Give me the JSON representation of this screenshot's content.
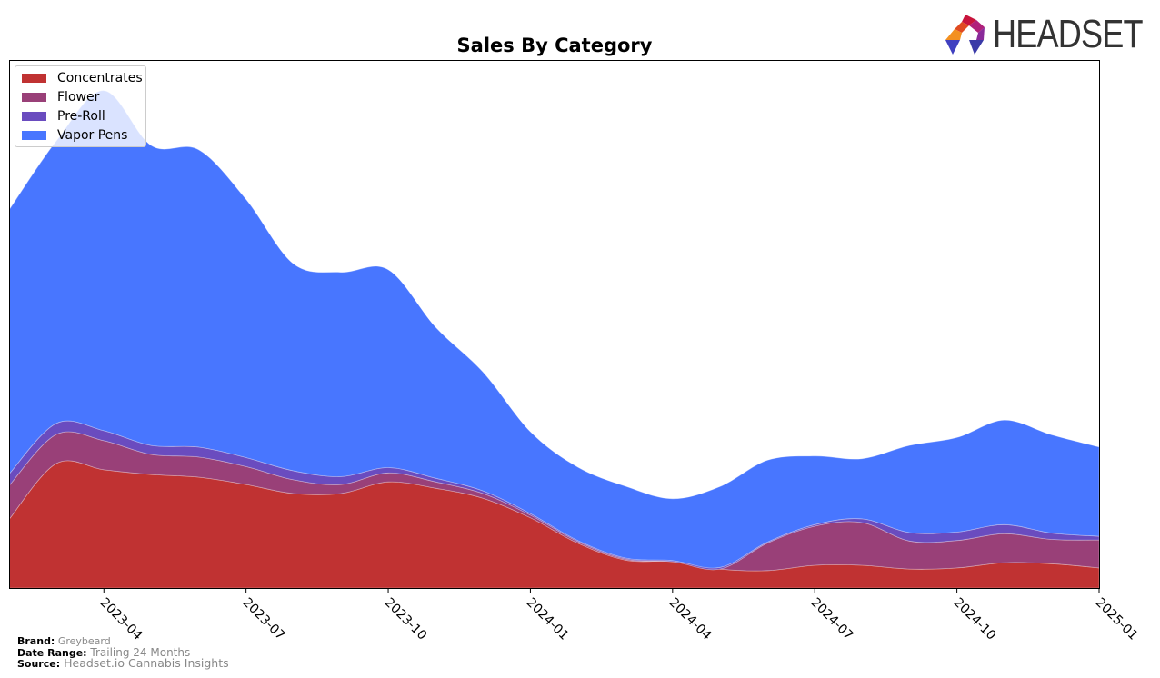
{
  "chart_data": {
    "type": "area",
    "stacked": true,
    "smoothed": true,
    "title": "Sales By Category",
    "xlabel": "",
    "ylabel": "",
    "y_axis_visible": false,
    "grid": false,
    "legend_position": "top-left",
    "x": [
      "2023-02",
      "2023-03",
      "2023-04",
      "2023-05",
      "2023-06",
      "2023-07",
      "2023-08",
      "2023-09",
      "2023-10",
      "2023-11",
      "2023-12",
      "2024-01",
      "2024-02",
      "2024-03",
      "2024-04",
      "2024-05",
      "2024-06",
      "2024-07",
      "2024-08",
      "2024-09",
      "2024-10",
      "2024-11",
      "2024-12",
      "2025-01"
    ],
    "x_ticks": [
      "2023-04",
      "2023-07",
      "2023-10",
      "2024-01",
      "2024-04",
      "2024-07",
      "2024-10",
      "2025-01"
    ],
    "ylim": [
      0,
      100
    ],
    "series": [
      {
        "name": "Concentrates",
        "color": "#c03232",
        "values": [
          13.0,
          23.6,
          22.4,
          21.5,
          21.0,
          19.6,
          17.9,
          17.9,
          20.1,
          18.9,
          17.0,
          13.3,
          8.5,
          5.3,
          5.0,
          3.6,
          3.3,
          4.3,
          4.3,
          3.6,
          3.8,
          4.8,
          4.6,
          3.8
        ]
      },
      {
        "name": "Flower",
        "color": "#994078",
        "values": [
          6.4,
          5.5,
          5.5,
          3.8,
          3.8,
          3.4,
          2.6,
          1.7,
          1.7,
          1.2,
          0.9,
          0.5,
          0.3,
          0.2,
          0.0,
          0.0,
          5.2,
          7.4,
          8.1,
          5.3,
          5.2,
          5.5,
          4.6,
          5.3
        ]
      },
      {
        "name": "Pre-Roll",
        "color": "#6a4cbf",
        "values": [
          2.2,
          2.1,
          1.9,
          1.7,
          1.9,
          1.7,
          1.7,
          1.5,
          1.0,
          0.7,
          0.5,
          0.3,
          0.2,
          0.2,
          0.2,
          0.3,
          0.2,
          0.3,
          0.7,
          1.6,
          1.6,
          1.7,
          1.2,
          0.7
        ]
      },
      {
        "name": "Vapor Pens",
        "color": "#4876ff",
        "values": [
          50.0,
          53.5,
          64.4,
          56.8,
          56.3,
          48.9,
          39.2,
          38.7,
          37.5,
          28.6,
          22.5,
          15.5,
          13.9,
          13.6,
          11.7,
          15.3,
          15.5,
          13.0,
          11.4,
          16.5,
          17.9,
          19.8,
          18.6,
          16.9
        ]
      }
    ]
  },
  "logo": {
    "text": "HEADSET"
  },
  "footer": {
    "brand_label": "Brand:",
    "brand_value": "Greybeard",
    "date_label": "Date Range:",
    "date_value": "Trailing 24 Months",
    "source_label": "Source:",
    "source_value": "Headset.io Cannabis Insights"
  }
}
